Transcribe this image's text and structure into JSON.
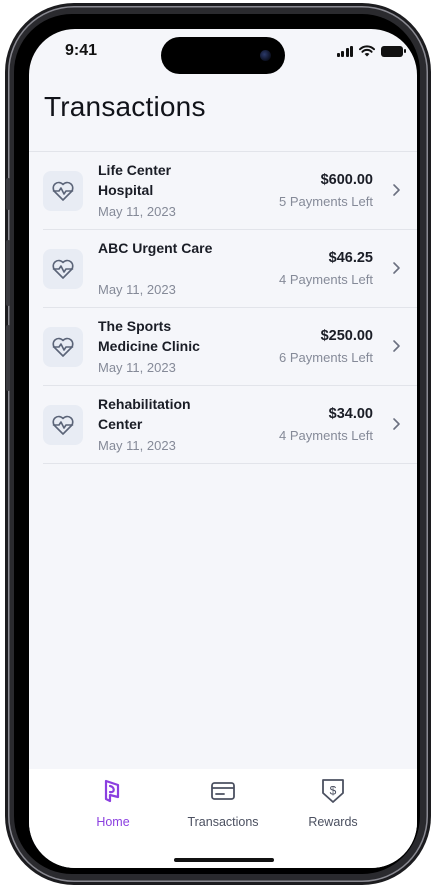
{
  "status_bar": {
    "time": "9:41"
  },
  "header": {
    "title": "Transactions"
  },
  "transactions": [
    {
      "name": "Life Center Hospital",
      "date": "May 11, 2023",
      "amount": "$600.00",
      "payments_left": "5 Payments Left",
      "icon": "heartbeat-icon"
    },
    {
      "name": "ABC Urgent Care",
      "date": "May 11, 2023",
      "amount": "$46.25",
      "payments_left": "4 Payments Left",
      "icon": "heartbeat-icon"
    },
    {
      "name": "The Sports Medicine Clinic",
      "date": "May 11, 2023",
      "amount": "$250.00",
      "payments_left": "6 Payments Left",
      "icon": "heartbeat-icon"
    },
    {
      "name": "Rehabilitation Center",
      "date": "May 11, 2023",
      "amount": "$34.00",
      "payments_left": "4 Payments Left",
      "icon": "heartbeat-icon"
    }
  ],
  "tabbar": {
    "active": "Home",
    "tabs": [
      {
        "label": "Home",
        "icon": "home-logo-icon"
      },
      {
        "label": "Transactions",
        "icon": "card-icon"
      },
      {
        "label": "Rewards",
        "icon": "dollar-shield-icon"
      }
    ]
  },
  "colors": {
    "accent": "#8b3fe0",
    "background": "#f5f6fa",
    "divider": "#e2e4ea",
    "icon_tile": "#e8ecf4"
  }
}
